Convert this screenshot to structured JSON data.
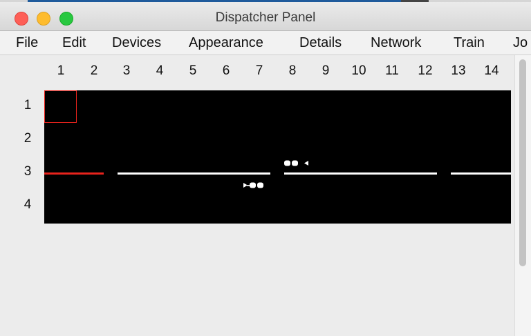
{
  "window": {
    "title": "Dispatcher Panel"
  },
  "menu": [
    {
      "label": "File"
    },
    {
      "label": "Edit"
    },
    {
      "label": "Devices"
    },
    {
      "label": "Appearance"
    },
    {
      "label": "Details"
    },
    {
      "label": "Network"
    },
    {
      "label": "Train"
    },
    {
      "label": "Jo"
    }
  ],
  "panel": {
    "column_headers": [
      "1",
      "2",
      "3",
      "4",
      "5",
      "6",
      "7",
      "8",
      "9",
      "10",
      "11",
      "12",
      "13",
      "14"
    ],
    "row_headers": [
      "1",
      "2",
      "3",
      "4"
    ],
    "selected_cell": {
      "row": 1,
      "col": 1
    },
    "colors": {
      "grid_background": "#000000",
      "occupied_track": "#e8231c",
      "free_track": "#ffffff",
      "selection_border": "#e8231c"
    },
    "trains": [
      {
        "name": "train-icon-left",
        "direction": "left",
        "row": 3
      },
      {
        "name": "train-icon-right",
        "direction": "right",
        "row": 3
      }
    ]
  }
}
